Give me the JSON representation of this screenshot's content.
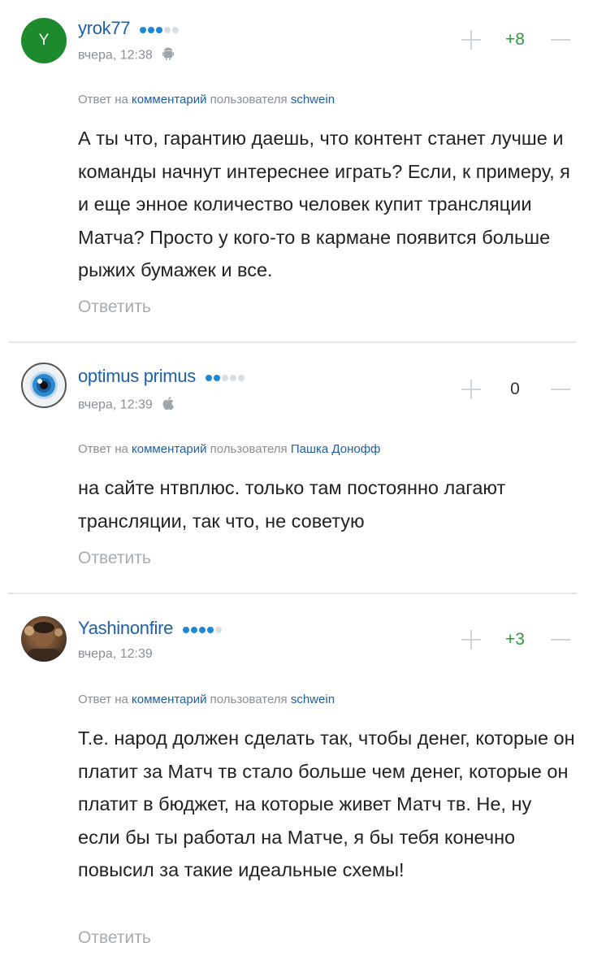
{
  "comments": [
    {
      "avatar_letter": "Y",
      "username": "yrok77",
      "rating_dots": [
        true,
        true,
        true,
        false,
        false
      ],
      "time": "вчера, 12:38",
      "device": "android-icon",
      "vote": "+8",
      "reply_prefix": "Ответ на",
      "reply_link": "комментарий",
      "reply_middle": "пользователя",
      "reply_user": "schwein",
      "text": "А ты что, гарантию даешь, что контент станет лучше и команды начнут интереснее играть? Если, к примеру, я и еще энное количество человек купит трансляции Матча? Просто у кого-то в кармане появится больше рыжих бумажек и все.",
      "answer_label": "Ответить"
    },
    {
      "avatar_letter": "",
      "username": "optimus primus",
      "rating_dots": [
        true,
        true,
        false,
        false,
        false
      ],
      "time": "вчера, 12:39",
      "device": "apple-icon",
      "vote": "0",
      "reply_prefix": "Ответ на",
      "reply_link": "комментарий",
      "reply_middle": "пользователя",
      "reply_user": "Пашка Донофф",
      "text": "на сайте нтвплюс. только там постоянно лагают трансляции, так что, не советую",
      "answer_label": "Ответить"
    },
    {
      "avatar_letter": "",
      "username": "Yashinonfire",
      "rating_dots": [
        true,
        true,
        true,
        true,
        false
      ],
      "time": "вчера, 12:39",
      "device": "",
      "vote": "+3",
      "reply_prefix": "Ответ на",
      "reply_link": "комментарий",
      "reply_middle": "пользователя",
      "reply_user": "schwein",
      "text": "Т.е. народ должен сделать так, чтобы денег, которые он платит за Матч тв стало больше чем денег, которые он платит в бюджет, на которые живет Матч тв. Не, ну если бы ты работал на Матче, я бы тебя конечно повысил за такие идеальные схемы!",
      "answer_label": "Ответить"
    }
  ],
  "colors": {
    "username": "#1e5fa8",
    "vote_positive": "#2e9a3a",
    "dot_on": "#1e88d8",
    "dot_off": "#d9dee3",
    "meta": "#8a8f94",
    "avatar_letter_bg": "#1e8a2e"
  }
}
